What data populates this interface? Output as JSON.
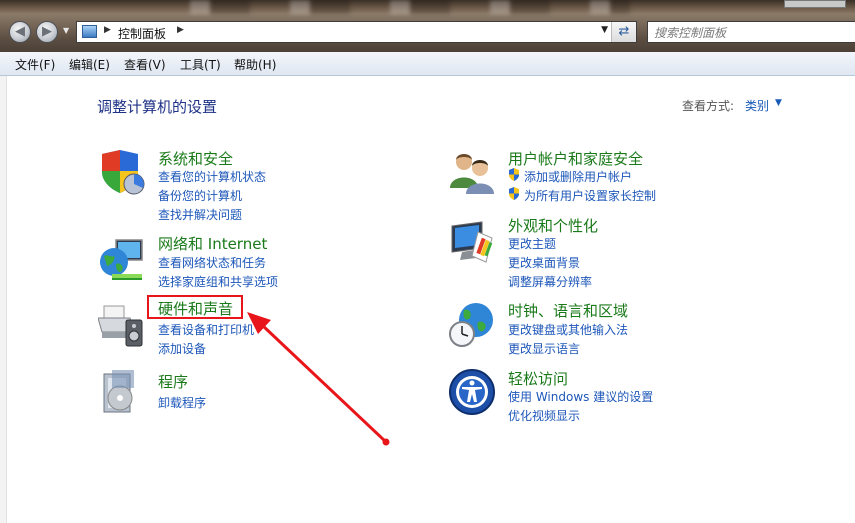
{
  "window": {
    "address_crumb": "控制面板",
    "search_placeholder": "搜索控制面板"
  },
  "menu": [
    "文件(F)",
    "编辑(E)",
    "查看(V)",
    "工具(T)",
    "帮助(H)"
  ],
  "page": {
    "title": "调整计算机的设置",
    "view_by_label": "查看方式:",
    "view_by_value": "类别"
  },
  "categories_left": [
    {
      "title": "系统和安全",
      "icon": "security-shield-icon",
      "links": [
        "查看您的计算机状态",
        "备份您的计算机",
        "查找并解决问题"
      ]
    },
    {
      "title": "网络和 Internet",
      "icon": "network-globe-icon",
      "links": [
        "查看网络状态和任务",
        "选择家庭组和共享选项"
      ]
    },
    {
      "title": "硬件和声音",
      "icon": "printer-speaker-icon",
      "links": [
        "查看设备和打印机",
        "添加设备"
      ]
    },
    {
      "title": "程序",
      "icon": "programs-box-icon",
      "links": [
        "卸载程序"
      ]
    }
  ],
  "categories_right": [
    {
      "title": "用户帐户和家庭安全",
      "icon": "users-icon",
      "links": [
        "添加或删除用户帐户",
        "为所有用户设置家长控制"
      ]
    },
    {
      "title": "外观和个性化",
      "icon": "monitor-palette-icon",
      "links": [
        "更改主题",
        "更改桌面背景",
        "调整屏幕分辨率"
      ]
    },
    {
      "title": "时钟、语言和区域",
      "icon": "clock-globe-icon",
      "links": [
        "更改键盘或其他输入法",
        "更改显示语言"
      ]
    },
    {
      "title": "轻松访问",
      "icon": "ease-of-access-icon",
      "links": [
        "使用 Windows 建议的设置",
        "优化视频显示"
      ]
    }
  ],
  "colors": {
    "category_title": "#1a7a1a",
    "link": "#1d57b9",
    "annotation": "#e8161a",
    "page_title": "#1e3287"
  }
}
